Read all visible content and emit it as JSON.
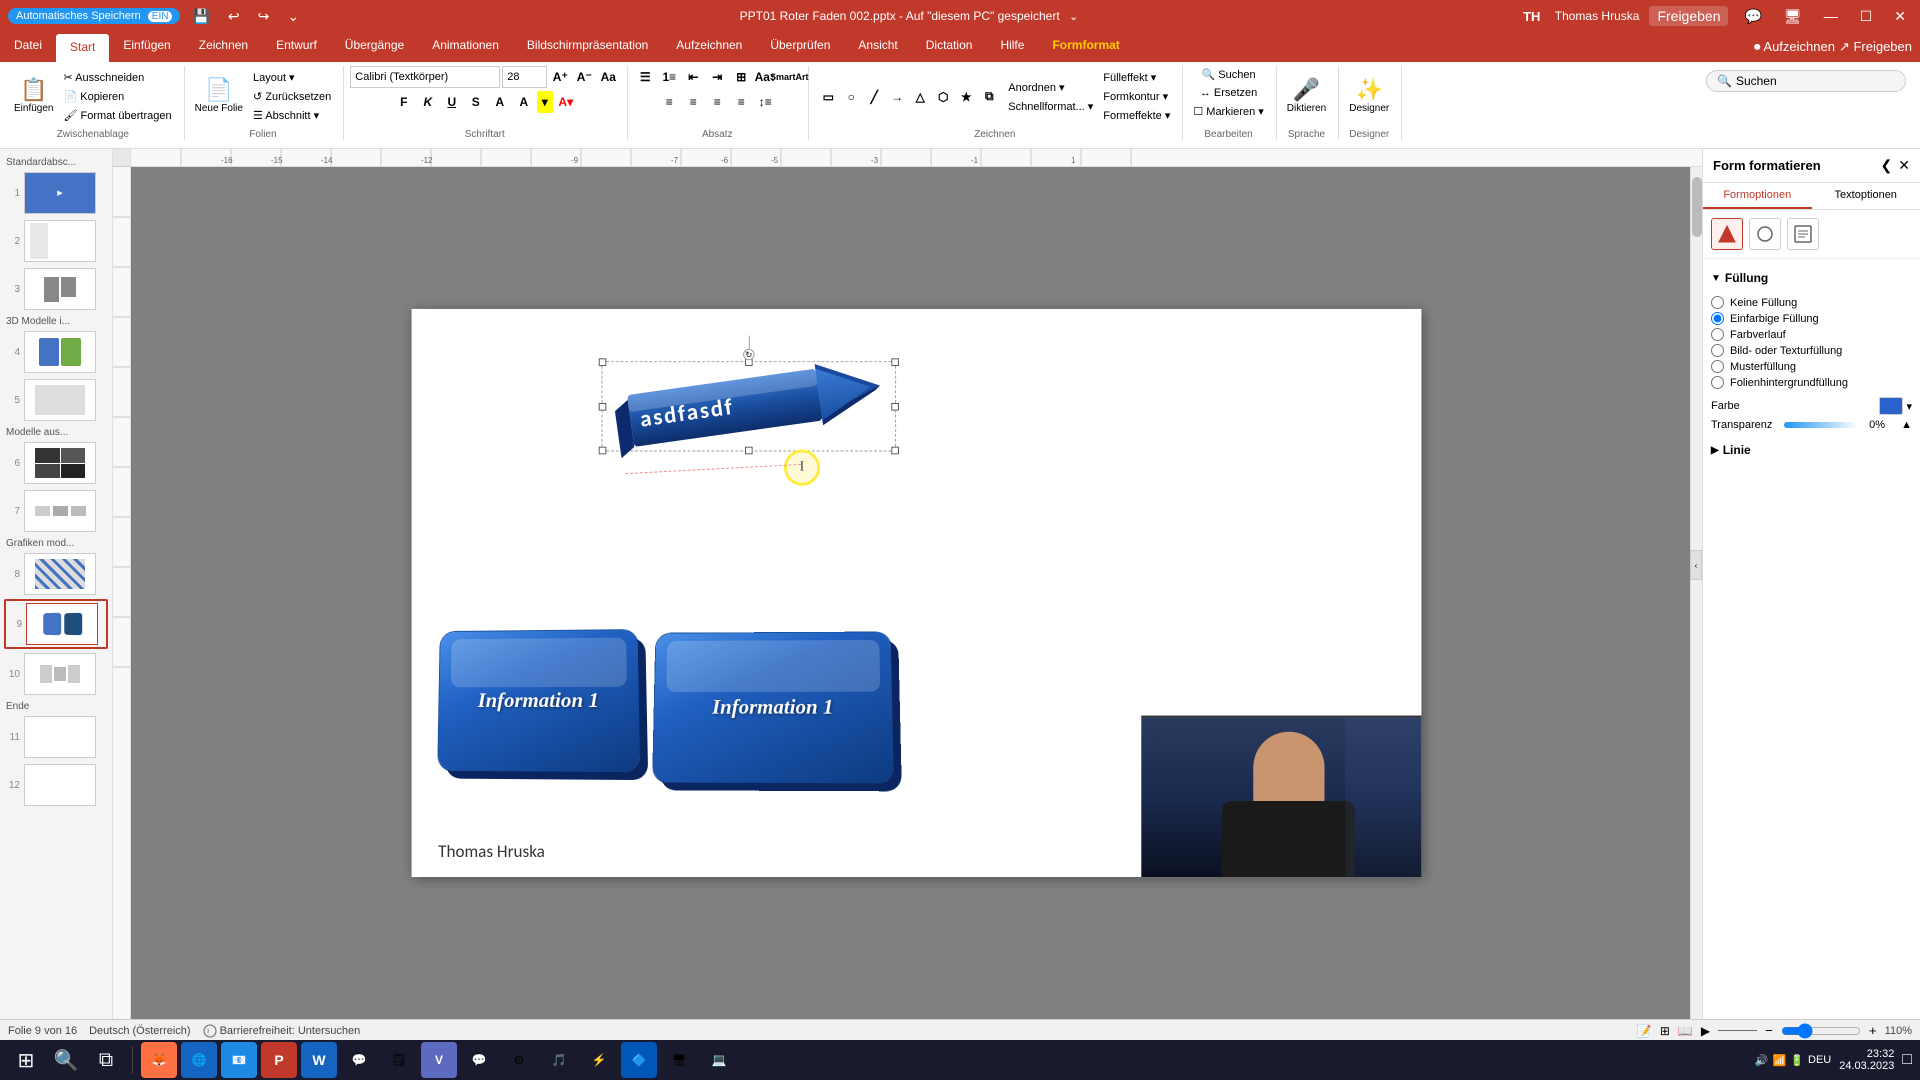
{
  "app": {
    "title": "PPT01 Roter Faden 002.pptx - Auf \"diesem PC\" gespeichert",
    "autosave_label": "Automatisches Speichern",
    "autosave_on": "●",
    "user": "Thomas Hruska",
    "window_controls": [
      "—",
      "☐",
      "✕"
    ]
  },
  "ribbon": {
    "tabs": [
      "Datei",
      "Start",
      "Einfügen",
      "Zeichnen",
      "Entwurf",
      "Übergänge",
      "Animationen",
      "Bildschirmpräsentation",
      "Aufzeichnen",
      "Überprüfen",
      "Ansicht",
      "Dictation",
      "Hilfe",
      "Formformat"
    ],
    "active_tab": "Start",
    "groups": {
      "clipboard": {
        "label": "Zwischenablage",
        "buttons": [
          "Einfügen",
          "Ausschneiden",
          "Kopieren",
          "Format übertragen"
        ]
      },
      "slides": {
        "label": "Folien",
        "buttons": [
          "Neue Folie",
          "Layout",
          "Zurücksetzen",
          "Abschnitt"
        ]
      },
      "font": {
        "label": "Schriftart",
        "font_name": "Calibri (Textkörper)",
        "font_size": "28",
        "buttons": [
          "F",
          "K",
          "U",
          "S",
          "A",
          "A"
        ]
      },
      "paragraph": {
        "label": "Absatz"
      },
      "drawing": {
        "label": "Zeichnen"
      },
      "editing": {
        "label": "Bearbeiten",
        "buttons": [
          "Suchen",
          "Ersetzen",
          "Markieren"
        ]
      },
      "voice": {
        "label": "Sprache",
        "buttons": [
          "Diktieren"
        ]
      },
      "designer_group": {
        "label": "Designer",
        "buttons": [
          "Designer"
        ]
      }
    }
  },
  "right_panel": {
    "title": "Form formatieren",
    "close_btn": "✕",
    "collapse_btn": "❮",
    "tabs": [
      "Formoptionen",
      "Textoptionen"
    ],
    "active_tab": "Formoptionen",
    "shape_icons": [
      "◆",
      "○",
      "⬜"
    ],
    "fill_section": {
      "title": "Füllung",
      "options": [
        {
          "id": "no_fill",
          "label": "Keine Füllung"
        },
        {
          "id": "solid_fill",
          "label": "Einfarbige Füllung",
          "checked": true
        },
        {
          "id": "gradient_fill",
          "label": "Farbverlauf"
        },
        {
          "id": "picture_fill",
          "label": "Bild- oder Texturfüllung"
        },
        {
          "id": "pattern_fill",
          "label": "Musterfüllung"
        },
        {
          "id": "slide_fill",
          "label": "Folienhintergrundfüllung"
        }
      ],
      "color_label": "Farbe",
      "transparency_label": "Transparenz",
      "transparency_value": "0%"
    },
    "line_section": {
      "title": "Linie"
    }
  },
  "slides": [
    {
      "num": "1",
      "group": "Standardabsc..."
    },
    {
      "num": "2",
      "group": null
    },
    {
      "num": "3",
      "group": null
    },
    {
      "num": "4",
      "group": "3D Modelle i..."
    },
    {
      "num": "5",
      "group": null
    },
    {
      "num": "6",
      "group": "Modelle aus..."
    },
    {
      "num": "7",
      "group": null
    },
    {
      "num": "8",
      "group": "Grafiken mod..."
    },
    {
      "num": "9",
      "group": null,
      "active": true
    },
    {
      "num": "10",
      "group": null
    },
    {
      "num": "11",
      "group": "Ende"
    },
    {
      "num": "12",
      "group": null
    }
  ],
  "slide": {
    "arrow_text": "asdfasdf",
    "key_btn_1_text": "Information 1",
    "key_btn_2_text": "Information 1",
    "name_label": "Thomas Hruska"
  },
  "statusbar": {
    "slide_info": "Folie 9 von 16",
    "language": "Deutsch (Österreich)",
    "accessibility": "Barrierefreiheit: Untersuchen",
    "zoom": "110%"
  },
  "taskbar": {
    "time": "23:32",
    "date": "24.03.2023",
    "apps": [
      "⊞",
      "🔍",
      "📋",
      "🦊",
      "🌐",
      "📊",
      "📝",
      "📬",
      "🔮",
      "V",
      "💬",
      "🗒",
      "⚙",
      "🎵",
      "⚡",
      "🔷",
      "🖥",
      "💻"
    ]
  }
}
